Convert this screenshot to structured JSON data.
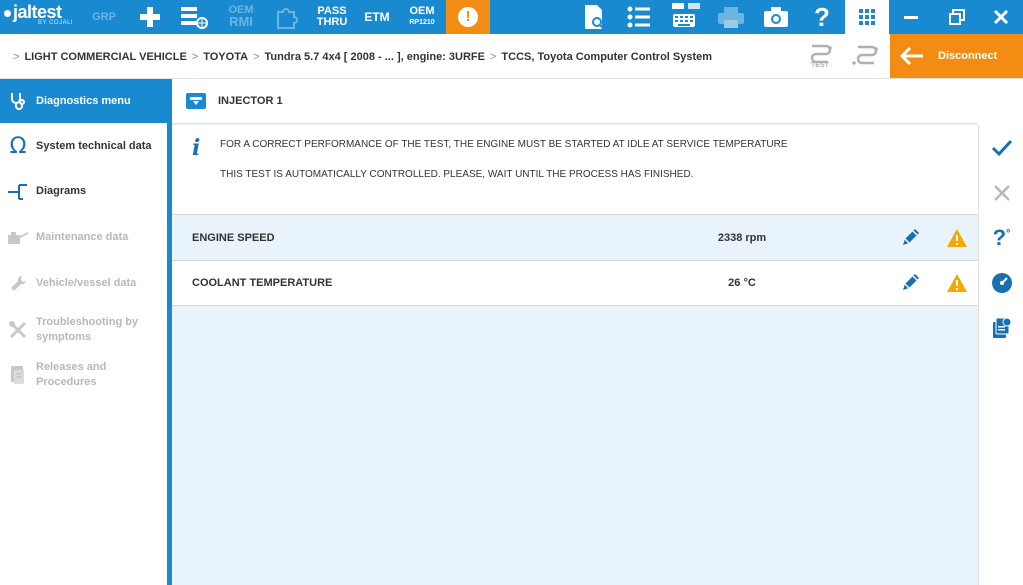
{
  "toolbar": {
    "logo": "jaltest",
    "logo_sub": "BY COJALI",
    "grp": "GRP",
    "oem_rmi": {
      "top": "OEM",
      "bottom": "RMI"
    },
    "pass_thru": {
      "top": "PASS",
      "bottom": "THRU"
    },
    "etm": "ETM",
    "oem_rp1210": {
      "top": "OEM",
      "bottom": "RP1210"
    },
    "alert_symbol": "!",
    "icons": [
      "plus-icon",
      "settings-network-icon",
      "puzzle-icon",
      "document-search-icon",
      "list-icon",
      "keyboard-icon",
      "printer-icon",
      "camera-icon",
      "help-icon",
      "grid-icon",
      "minimize-icon",
      "restore-icon",
      "close-icon"
    ]
  },
  "breadcrumb": {
    "items": [
      "LIGHT COMMERCIAL VEHICLE",
      "TOYOTA",
      "Tundra 5.7 4x4 [ 2008 - ... ], engine: 3URFE",
      "TCCS, Toyota Computer Control System"
    ],
    "separator": ">"
  },
  "test_label": "TEST",
  "disconnect_label": "Disconnect",
  "sidebar": {
    "items": [
      {
        "label": "Diagnostics menu",
        "state": "active"
      },
      {
        "label": "System technical data",
        "state": "normal"
      },
      {
        "label": "Diagrams",
        "state": "normal"
      },
      {
        "label": "Maintenance data",
        "state": "disabled"
      },
      {
        "label": "Vehicle/vessel data",
        "state": "disabled"
      },
      {
        "label": "Troubleshooting by symptoms",
        "state": "disabled"
      },
      {
        "label": "Releases and Procedures",
        "state": "disabled"
      }
    ]
  },
  "panel": {
    "title": "INJECTOR 1",
    "info_symbol": "i",
    "info_line1": "FOR A CORRECT PERFORMANCE OF THE TEST, THE ENGINE MUST BE STARTED AT IDLE AT SERVICE TEMPERATURE",
    "info_line2": "THIS TEST IS AUTOMATICALLY CONTROLLED. PLEASE, WAIT UNTIL THE PROCESS HAS FINISHED.",
    "parameters": [
      {
        "name": "ENGINE SPEED",
        "value": "2338 rpm"
      },
      {
        "name": "COOLANT TEMPERATURE",
        "value": "26 °C"
      }
    ]
  },
  "colors": {
    "accent": "#1a8ad0",
    "orange": "#f28c13",
    "warning": "#f5a800",
    "panel_bg": "#e8f3fb"
  }
}
